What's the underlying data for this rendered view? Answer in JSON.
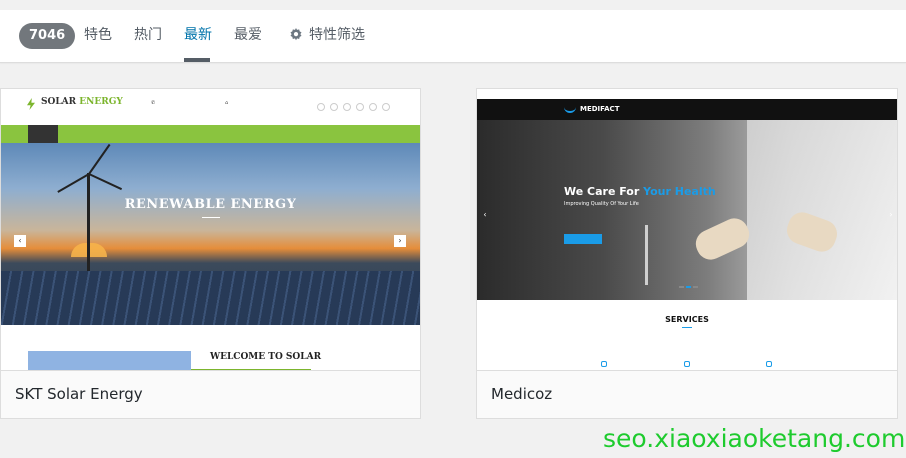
{
  "filter_bar": {
    "count": "7046",
    "tabs": [
      {
        "label": "特色",
        "active": false
      },
      {
        "label": "热门",
        "active": false
      },
      {
        "label": "最新",
        "active": true
      },
      {
        "label": "最爱",
        "active": false
      }
    ],
    "feature_filter": {
      "label": "特性筛选",
      "icon": "gear-icon"
    }
  },
  "themes": [
    {
      "name": "SKT Solar Energy",
      "preview": {
        "logo_text": "SOLAR",
        "logo_accent": "ENERGY",
        "hero_title": "RENEWABLE ENERGY",
        "section_title": "WELCOME TO SOLAR",
        "brand_color": "#8ac43f"
      }
    },
    {
      "name": "Medicoz",
      "preview": {
        "logo_text": "MEDIFACT",
        "hero_title": "We Care For",
        "hero_title_accent": "Your Health",
        "hero_subtitle": "Improving Quality Of Your Life",
        "section_title": "SERVICES",
        "brand_color": "#1a9ce8"
      }
    }
  ],
  "watermark": "seo.xiaoxiaoketang.com",
  "colors": {
    "active_tab": "#0073aa",
    "count_badge": "#72777c",
    "watermark": "#1ecb2e"
  }
}
